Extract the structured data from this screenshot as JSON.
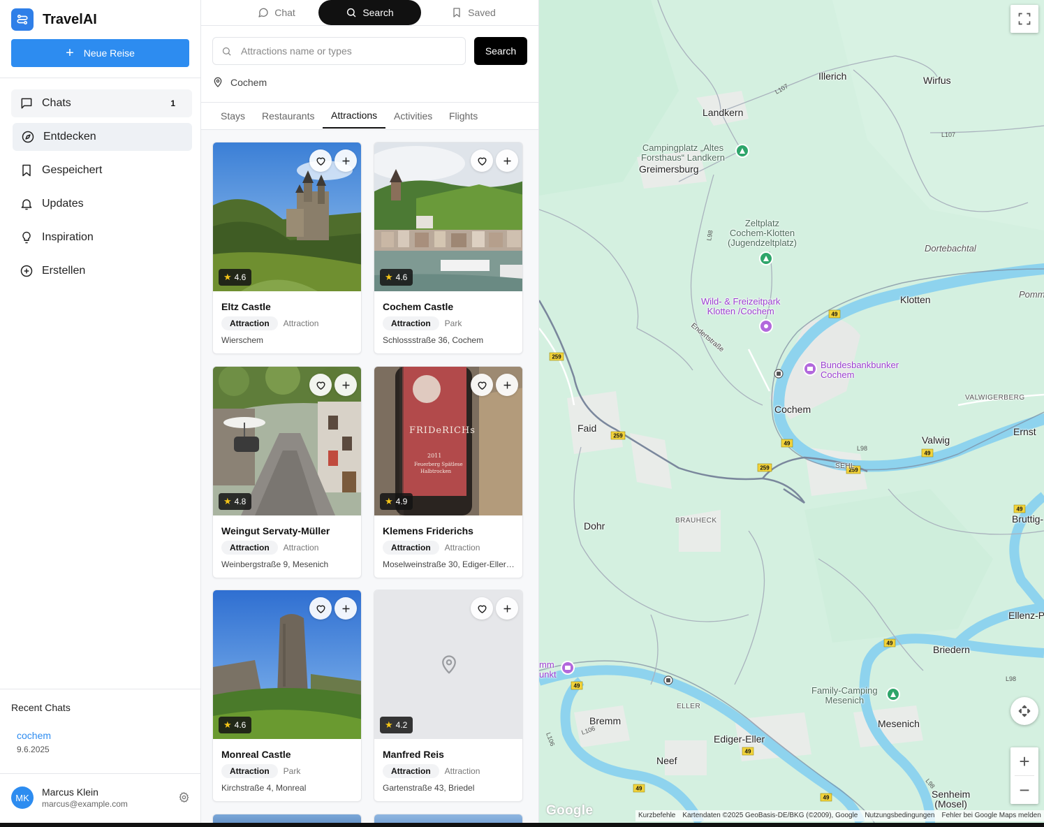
{
  "app": {
    "name": "TravelAI",
    "new_trip_label": "Neue Reise"
  },
  "sidebar": {
    "items": [
      {
        "label": "Chats",
        "icon": "message-square-icon",
        "badge": "1"
      },
      {
        "label": "Entdecken",
        "icon": "compass-icon"
      },
      {
        "label": "Gespeichert",
        "icon": "bookmark-icon"
      },
      {
        "label": "Updates",
        "icon": "bell-icon"
      },
      {
        "label": "Inspiration",
        "icon": "lightbulb-icon"
      },
      {
        "label": "Erstellen",
        "icon": "plus-circle-icon"
      }
    ],
    "recent_title": "Recent Chats",
    "recent": [
      {
        "name": "cochem",
        "date": "9.6.2025"
      }
    ],
    "user": {
      "initials": "MK",
      "name": "Marcus Klein",
      "email": "marcus@example.com"
    }
  },
  "panel": {
    "mode_tabs": [
      {
        "label": "Chat",
        "icon": "message-circle-icon"
      },
      {
        "label": "Search",
        "icon": "search-icon",
        "active": true
      },
      {
        "label": "Saved",
        "icon": "bookmark-icon"
      }
    ],
    "search": {
      "placeholder": "Attractions name or types",
      "value": "",
      "button_label": "Search"
    },
    "location": "Cochem",
    "category_tabs": [
      "Stays",
      "Restaurants",
      "Attractions",
      "Activities",
      "Flights"
    ],
    "active_category": "Attractions",
    "cards": [
      {
        "title": "Eltz Castle",
        "rating": "4.6",
        "tag": "Attraction",
        "type": "Attraction",
        "address": "Wierschem"
      },
      {
        "title": "Cochem Castle",
        "rating": "4.6",
        "tag": "Attraction",
        "type": "Park",
        "address": "Schlossstraße 36, Cochem"
      },
      {
        "title": "Weingut Servaty-Müller",
        "rating": "4.8",
        "tag": "Attraction",
        "type": "Attraction",
        "address": "Weinbergstraße 9, Mesenich"
      },
      {
        "title": "Klemens Friderichs",
        "rating": "4.9",
        "tag": "Attraction",
        "type": "Attraction",
        "address": "Moselweinstraße 30, Ediger-Eller…"
      },
      {
        "title": "Monreal Castle",
        "rating": "4.6",
        "tag": "Attraction",
        "type": "Park",
        "address": "Kirchstraße 4, Monreal"
      },
      {
        "title": "Manfred Reis",
        "rating": "4.2",
        "tag": "Attraction",
        "type": "Attraction",
        "address": "Gartenstraße 43, Briedel"
      }
    ],
    "wine_label": {
      "brand": "FRIDeRICHs",
      "year": "2011",
      "line1": "Feuerberg Spätlese",
      "line2": "Halbtrocken"
    }
  },
  "map": {
    "labels": {
      "illerich": "Illerich",
      "wirfus": "Wirfus",
      "landkern": "Landkern",
      "greimersburg": "Greimersburg",
      "klotten": "Klotten",
      "cochem": "Cochem",
      "faid": "Faid",
      "valwig": "Valwig",
      "ernst": "Ernst",
      "dohr": "Dohr",
      "bruttig": "Bruttig-",
      "ellenz": "Ellenz-P",
      "briedern": "Briedern",
      "mesenich": "Mesenich",
      "bremm": "Bremm",
      "ediger": "Ediger-Eller",
      "neef": "Neef",
      "senheim": "Senheim\n(Mosel)",
      "dortebachtal": "Dortebachtal",
      "pomm": "Pomm",
      "camping_landkern": "Campingplatz „Altes\nForsthaus“ Landkern",
      "zeltplatz": "Zeltplatz\nCochem-Klotten\n(Jugendzeltplatz)",
      "wildpark": "Wild- & Freizeitpark\nKlotten /Cochem",
      "bunker": "Bundesbankbunker\nCochem",
      "family_camping": "Family-Camping\nMesenich",
      "calmont": "mm\nunkt",
      "valwigerberg": "VALWIGERBERG",
      "brauheck": "BRAUHECK",
      "sehl": "SEHL",
      "eller": "ELLER",
      "endertstrasse": "Endertstraße"
    },
    "road_labels": [
      "L107",
      "L107",
      "L98",
      "49",
      "259",
      "259",
      "259",
      "L98",
      "49",
      "49",
      "49",
      "49",
      "49",
      "L98",
      "L106",
      "L106",
      "49",
      "49",
      "49",
      "L98"
    ],
    "attribution": [
      "Kurzbefehle",
      "Kartendaten ©2025 GeoBasis-DE/BKG (©2009), Google",
      "Nutzungsbedingungen",
      "Fehler bei Google Maps melden"
    ],
    "logo": "Google",
    "controls": {
      "zoom_in": "+",
      "zoom_out": "−"
    },
    "colors": {
      "land": "#d4f0e0",
      "river": "#8ed3ee",
      "road": "#ffffff",
      "major_road": "#7a879c"
    }
  },
  "colors": {
    "accent": "#2d8cf0",
    "active_tab": "#111111"
  }
}
